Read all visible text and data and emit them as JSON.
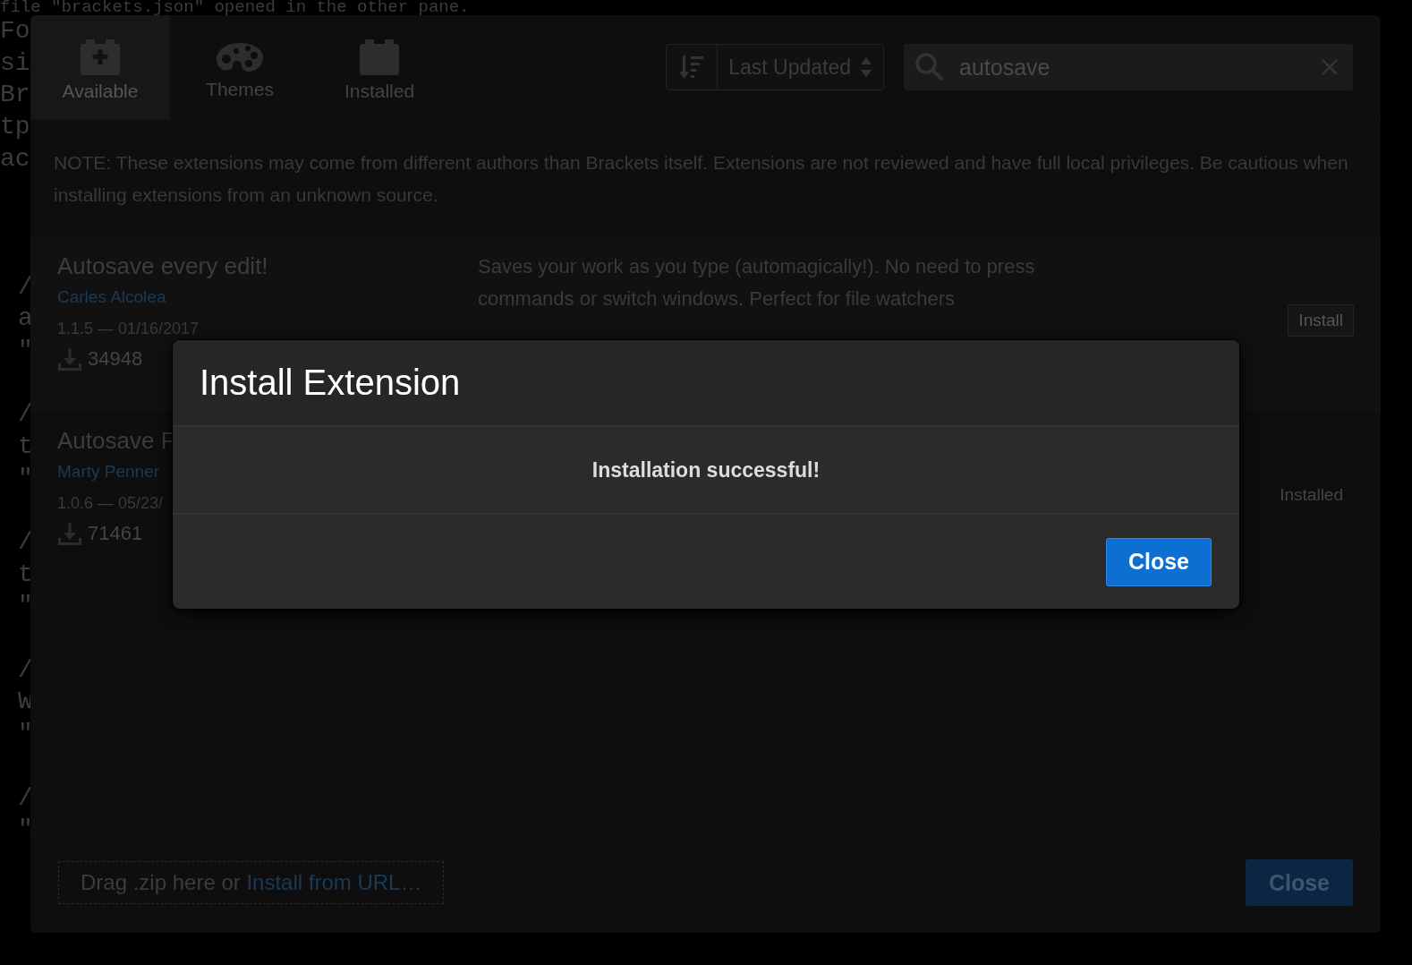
{
  "editor": {
    "lines": [
      {
        "text": "file \"brackets.json\" opened in the other pane."
      },
      {
        "text": "Fo"
      },
      {
        "text": "si"
      },
      {
        "text": "Br"
      },
      {
        "text": "tp"
      },
      {
        "text": "ac"
      },
      {
        "text": "/"
      },
      {
        "text": "a"
      },
      {
        "text": "\""
      },
      {
        "text": "/"
      },
      {
        "text": "t"
      },
      {
        "text": "\""
      },
      {
        "text": "/"
      },
      {
        "text": "t"
      },
      {
        "text": "\""
      },
      {
        "text": "/"
      },
      {
        "text": "W"
      },
      {
        "text": "\""
      },
      {
        "text": "/"
      },
      {
        "text": "\""
      }
    ]
  },
  "extension_manager": {
    "tabs": [
      {
        "label": "Available",
        "selected": true
      },
      {
        "label": "Themes",
        "selected": false
      },
      {
        "label": "Installed",
        "selected": false
      }
    ],
    "sort": {
      "value": "Last Updated"
    },
    "search": {
      "value": "autosave"
    },
    "note": "NOTE: These extensions may come from different authors than Brackets itself. Extensions are not reviewed and have full local privileges. Be cautious when installing extensions from an unknown source.",
    "extensions": [
      {
        "title": "Autosave every edit!",
        "author": "Carles Alcolea",
        "version": "1.1.5 — 01/16/2017",
        "downloads": "34948",
        "description": "Saves your work as you type (automagically!). No need to press commands or switch windows. Perfect for file watchers",
        "button": {
          "label": "Install",
          "disabled": false
        }
      },
      {
        "title": "Autosave F",
        "author": "Marty Penner",
        "version": "1.0.6 — 05/23/",
        "downloads": "71461",
        "button": {
          "label": "Installed",
          "disabled": true
        }
      }
    ],
    "footer": {
      "drop_text": "Drag .zip here or ",
      "link": "Install from URL…",
      "close": "Close"
    }
  },
  "dialog": {
    "title": "Install Extension",
    "message": "Installation successful!",
    "button": "Close"
  }
}
